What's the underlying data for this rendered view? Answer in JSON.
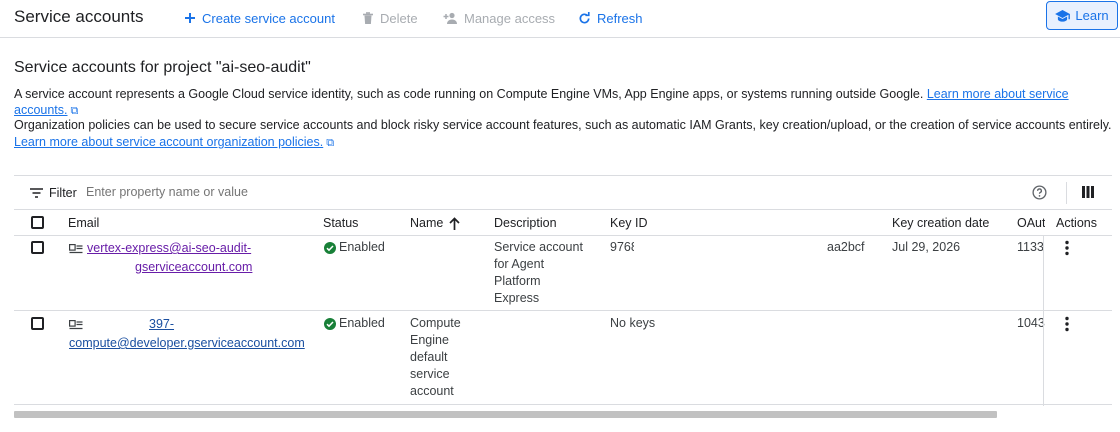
{
  "header": {
    "title": "Service accounts",
    "create_label": "Create service account",
    "delete_label": "Delete",
    "manage_label": "Manage access",
    "refresh_label": "Refresh",
    "learn_label": "Learn"
  },
  "intro": {
    "title": "Service accounts for project \"ai-seo-audit\"",
    "p1_text": "A service account represents a Google Cloud service identity, such as code running on Compute Engine VMs, App Engine apps, or systems running outside Google.",
    "p1_link": "Learn more about service accounts.",
    "p2_text": "Organization policies can be used to secure service accounts and block risky service account features, such as automatic IAM Grants, key creation/upload, or the creation of service accounts entirely.",
    "p2_link_a": "Learn",
    "p2_link_b": "more about service account organization policies."
  },
  "filter": {
    "label": "Filter",
    "placeholder": "Enter property name or value"
  },
  "table": {
    "columns": {
      "email": "Email",
      "status": "Status",
      "name": "Name",
      "description": "Description",
      "key_id": "Key ID",
      "key_date": "Key creation date",
      "oauth": "OAut",
      "actions": "Actions"
    },
    "rows": [
      {
        "email_l1": "vertex-express@ai-seo-audit-",
        "email_l2": "gserviceaccount.com",
        "status": "Enabled",
        "name_lines": [
          "",
          "",
          "",
          "",
          ""
        ],
        "desc_lines": [
          "Service account",
          "for Agent",
          "Platform",
          "Express"
        ],
        "key_id_prefix": "9768",
        "key_id_suffix": "aa2bcf",
        "key_date": "Jul 29, 2026",
        "oauth": "1133"
      },
      {
        "email_l1": "397-",
        "email_l2": "compute@developer.gserviceaccount.com",
        "status": "Enabled",
        "name_lines": [
          "Compute",
          "Engine",
          "default",
          "service",
          "account"
        ],
        "desc_lines": [
          "",
          "",
          "",
          ""
        ],
        "key_id_prefix": "No keys",
        "key_id_suffix": "",
        "key_date": "",
        "oauth": "1043"
      }
    ]
  },
  "colors": {
    "accent": "#1a73e8",
    "visited_link": "#681da8",
    "status_green": "#188038",
    "border": "#dadce0"
  }
}
